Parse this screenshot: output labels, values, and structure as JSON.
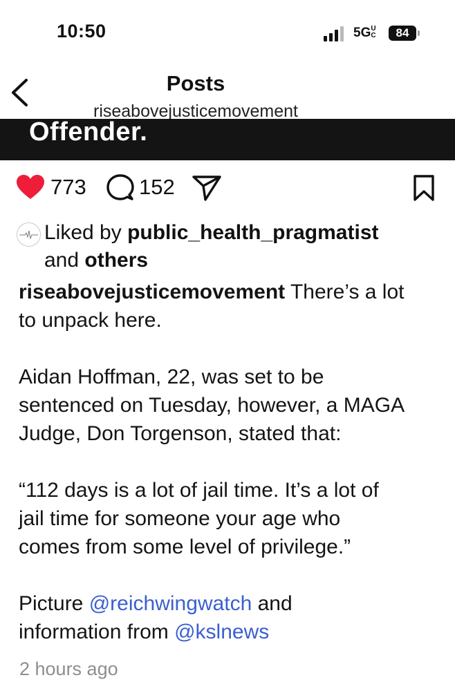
{
  "status_bar": {
    "time": "10:50",
    "network": "5G",
    "network_superscript": "UC",
    "battery": "84",
    "icons": [
      "signal-icon",
      "battery-icon"
    ]
  },
  "header": {
    "title": "Posts",
    "subtitle": "riseabovejusticemovement",
    "back_icon": "chevron-left-icon"
  },
  "post_image": {
    "visible_text": "Offender."
  },
  "actions": {
    "likes": "773",
    "comments": "152",
    "icons": [
      "heart-icon",
      "comment-icon",
      "share-icon",
      "bookmark-icon"
    ],
    "heart_color": "#ee1d3a"
  },
  "liked_by": {
    "prefix": "Liked by ",
    "user": "public_health_pragmatist",
    "and": "and ",
    "others": "others"
  },
  "caption": {
    "username": "riseabovejusticemovement",
    "line1_rest": " There’s a lot",
    "line2": "to unpack here.",
    "para2": [
      "Aidan Hoffman, 22, was set to be",
      "sentenced on Tuesday, however, a MAGA",
      "Judge, Don Torgenson, stated that:"
    ],
    "quote": [
      "“112 days is a lot of jail time. It’s a lot of",
      "jail time for someone your age who",
      "comes from some level of privilege.”"
    ],
    "credit_prefix": "Picture ",
    "mention1": "@reichwingwatch",
    "credit_mid": " and",
    "credit_line2_prefix": "information from ",
    "mention2": "@kslnews",
    "mention_color": "#3a5fd0"
  },
  "timestamp": "2 hours ago"
}
